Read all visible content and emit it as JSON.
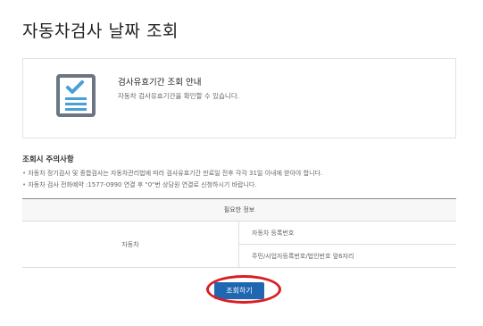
{
  "page": {
    "title": "자동차검사 날짜 조회"
  },
  "info_box": {
    "icon": "checklist-icon",
    "title": "검사유효기간 조회 안내",
    "description": "자동차 검사유효기간을 확인할 수 있습니다."
  },
  "caution": {
    "title": "조회시 주의사항",
    "items": [
      "자동차 정기검사 및 종합검사는 자동차관리법에 따라 검사유효기간 만료일 전후 각각 31일 이내에 받아야 합니다.",
      "자동차 검사 전화예약 :1577-0990 연결 후 \"0\"번 상담원 연결로 신청하시기 바랍니다."
    ]
  },
  "required_info": {
    "header": "필요한 정보",
    "category": "자동차",
    "items": [
      "자동차 등록번호",
      "주민/사업자등록번호/법인번호 앞6자리"
    ]
  },
  "actions": {
    "search_label": "조회하기"
  },
  "colors": {
    "button_blue": "#1f67b0",
    "highlight_red": "#d91e25",
    "icon_blue": "#4a9fd8",
    "icon_frame": "#6b7680"
  }
}
